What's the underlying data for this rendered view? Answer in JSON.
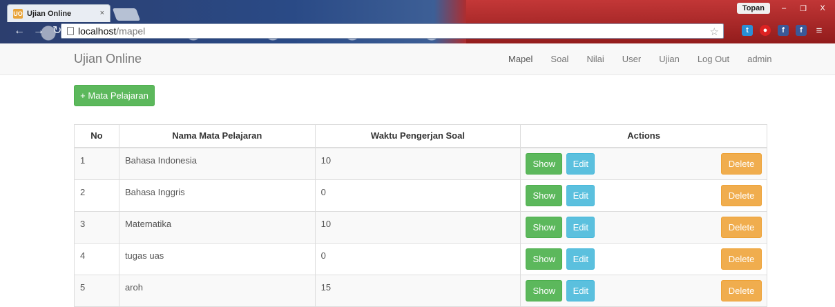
{
  "browser": {
    "tab_title": "Ujian Online",
    "tab_close": "×",
    "profile_name": "Topan",
    "window_minimize": "–",
    "window_restore": "❐",
    "window_close": "X",
    "url_host": "localhost",
    "url_path": "/mapel",
    "nav_back_icon": "back-icon",
    "nav_forward_icon": "forward-icon",
    "nav_reload_icon": "reload-icon",
    "extensions": [
      "twitter-icon",
      "record-icon",
      "facebook-icon",
      "facebook-icon",
      "menu-icon"
    ]
  },
  "navbar": {
    "brand": "Ujian Online",
    "links": [
      {
        "label": "Mapel"
      },
      {
        "label": "Soal"
      },
      {
        "label": "Nilai"
      },
      {
        "label": "User"
      },
      {
        "label": "Ujian"
      },
      {
        "label": "Log Out"
      },
      {
        "label": "admin"
      }
    ]
  },
  "main": {
    "add_button": "+ Mata Pelajaran",
    "table": {
      "headers": [
        "No",
        "Nama Mata Pelajaran",
        "Waktu Pengerjan Soal",
        "Actions"
      ],
      "rows": [
        {
          "no": "1",
          "name": "Bahasa Indonesia",
          "time": "10"
        },
        {
          "no": "2",
          "name": "Bahasa Inggris",
          "time": "0"
        },
        {
          "no": "3",
          "name": "Matematika",
          "time": "10"
        },
        {
          "no": "4",
          "name": "tugas uas",
          "time": "0"
        },
        {
          "no": "5",
          "name": "aroh",
          "time": "15"
        }
      ],
      "action_labels": {
        "show": "Show",
        "edit": "Edit",
        "delete": "Delete"
      }
    }
  },
  "colors": {
    "success": "#5cb85c",
    "info": "#5bc0de",
    "warning": "#f0ad4e"
  }
}
